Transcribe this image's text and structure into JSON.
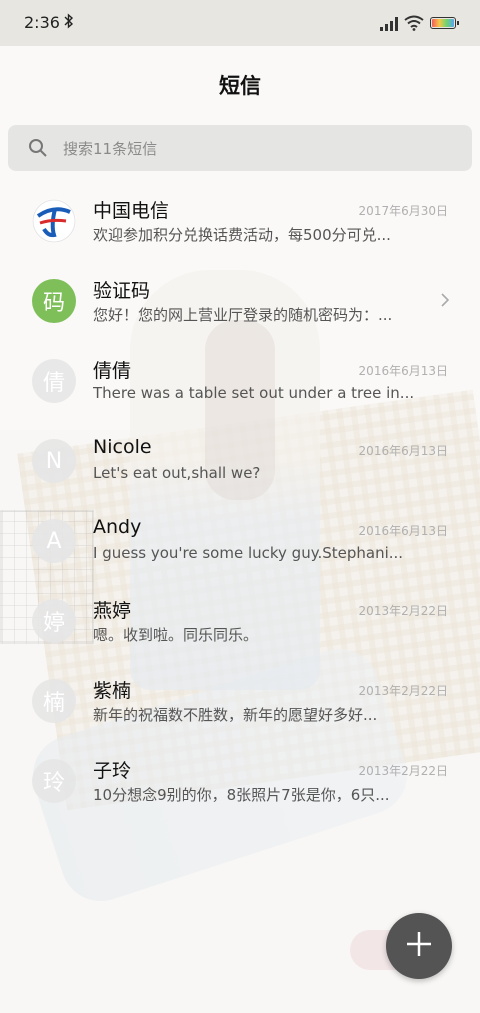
{
  "status": {
    "time": "2:36",
    "battery_level": 1.0
  },
  "header": {
    "title": "短信"
  },
  "search": {
    "placeholder": "搜索11条短信"
  },
  "conversations": [
    {
      "name": "中国电信",
      "date": "2017年6月30日",
      "preview": "欢迎参加积分兑换话费活动，每500分可兑...",
      "avatar": "telecom-logo"
    },
    {
      "name": "验证码",
      "date": "",
      "preview": "您好！您的网上营业厅登录的随机密码为：...",
      "avatar_text": "码",
      "avatar_color": "#7fbf5a"
    },
    {
      "name": "倩倩",
      "date": "2016年6月13日",
      "preview": "There was a table set out under a tree in...",
      "avatar_text": "倩"
    },
    {
      "name": "Nicole",
      "date": "2016年6月13日",
      "preview": "Let's eat out,shall we?",
      "avatar_text": "N"
    },
    {
      "name": "Andy",
      "date": "2016年6月13日",
      "preview": "I guess you're some lucky guy.Stephani...",
      "avatar_text": "A"
    },
    {
      "name": "燕婷",
      "date": "2013年2月22日",
      "preview": "嗯。收到啦。同乐同乐。",
      "avatar_text": "婷"
    },
    {
      "name": "紫楠",
      "date": "2013年2月22日",
      "preview": "新年的祝福数不胜数，新年的愿望好多好...",
      "avatar_text": "楠"
    },
    {
      "name": "子玲",
      "date": "2013年2月22日",
      "preview": "10分想念9别的你，8张照片7张是你，6只...",
      "avatar_text": "玲"
    }
  ],
  "fab": {
    "icon": "plus-icon"
  }
}
